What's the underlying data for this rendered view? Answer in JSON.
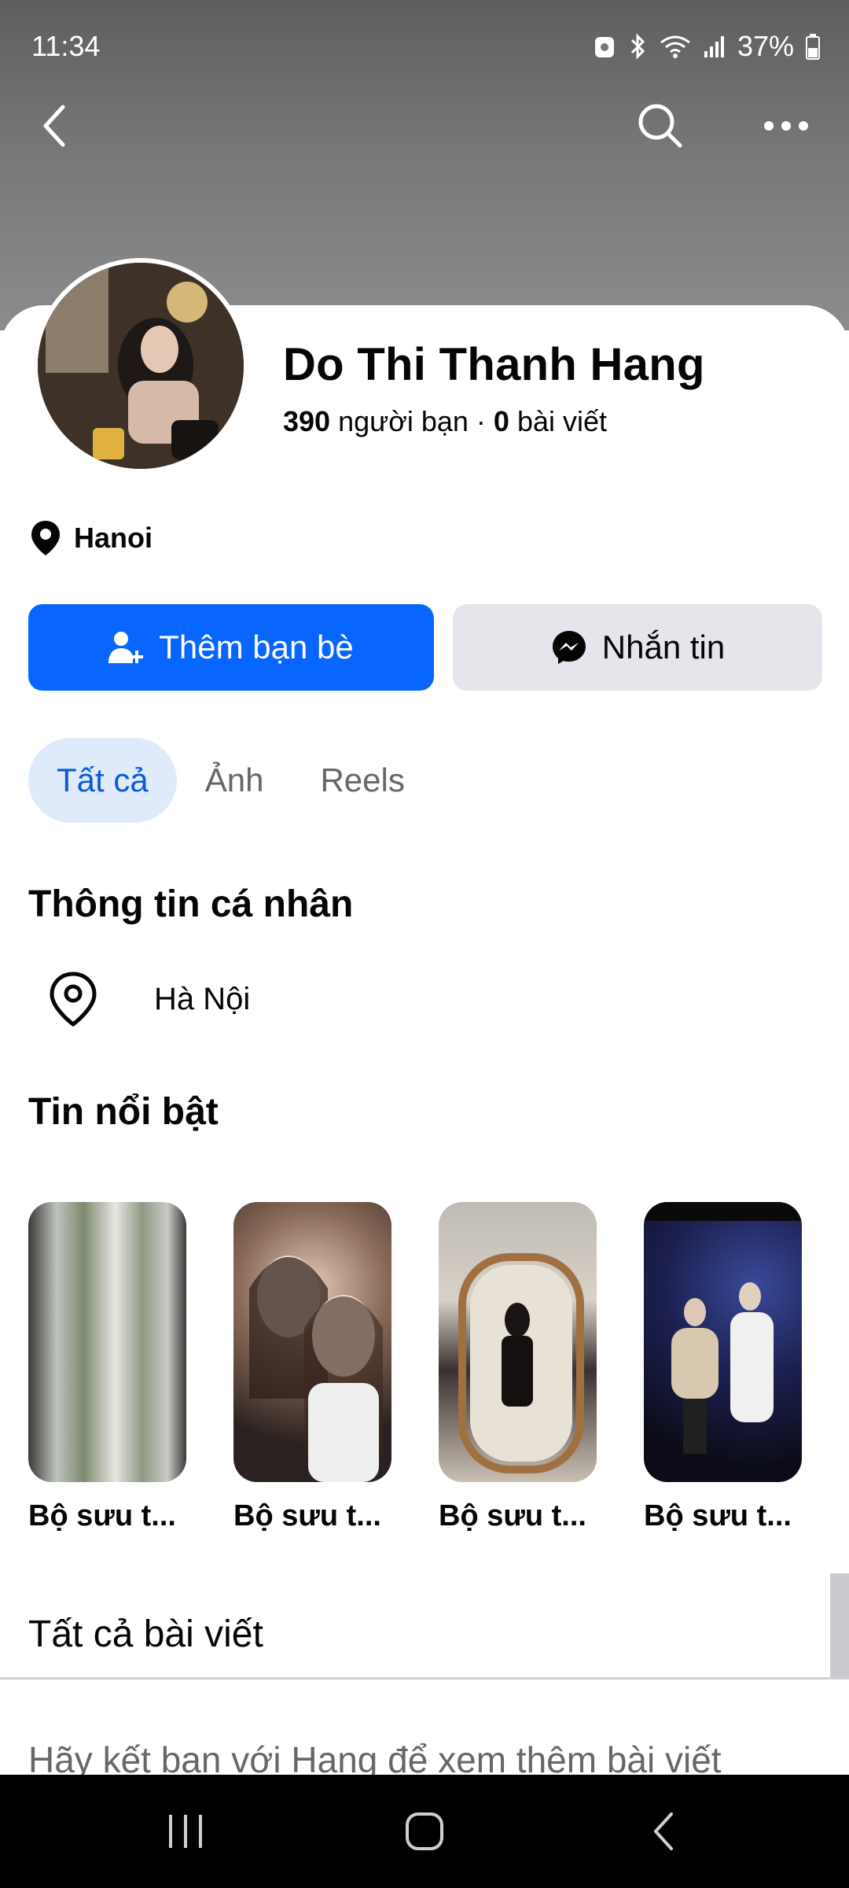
{
  "status_bar": {
    "time": "11:34",
    "battery": "37%"
  },
  "profile": {
    "name": "Do Thi Thanh Hang",
    "friends_count": "390",
    "friends_label": "người bạn",
    "separator": "·",
    "posts_count": "0",
    "posts_label": "bài viết",
    "location": "Hanoi"
  },
  "actions": {
    "add_friend": "Thêm bạn bè",
    "message": "Nhắn tin"
  },
  "tabs": [
    {
      "label": "Tất cả",
      "active": true
    },
    {
      "label": "Ảnh",
      "active": false
    },
    {
      "label": "Reels",
      "active": false
    }
  ],
  "personal_info": {
    "title": "Thông tin cá nhân",
    "location": "Hà Nội"
  },
  "highlights": {
    "title": "Tin nổi bật",
    "items": [
      {
        "label": "Bộ sưu t..."
      },
      {
        "label": "Bộ sưu t..."
      },
      {
        "label": "Bộ sưu t..."
      },
      {
        "label": "Bộ sưu t..."
      }
    ]
  },
  "posts": {
    "title": "Tất cả bài viết",
    "hint": "Hãy kết bạn với Hang để xem thêm bài viết"
  },
  "colors": {
    "primary": "#0866ff",
    "secondary_button": "#e4e6eb",
    "active_tab_bg": "#dfeafb",
    "active_tab_text": "#0a5bd6"
  },
  "icons": {
    "back": "chevron-left-icon",
    "search": "search-icon",
    "more": "more-horizontal-icon",
    "location": "location-pin-icon",
    "add_friend": "add-person-icon",
    "messenger": "messenger-icon"
  }
}
